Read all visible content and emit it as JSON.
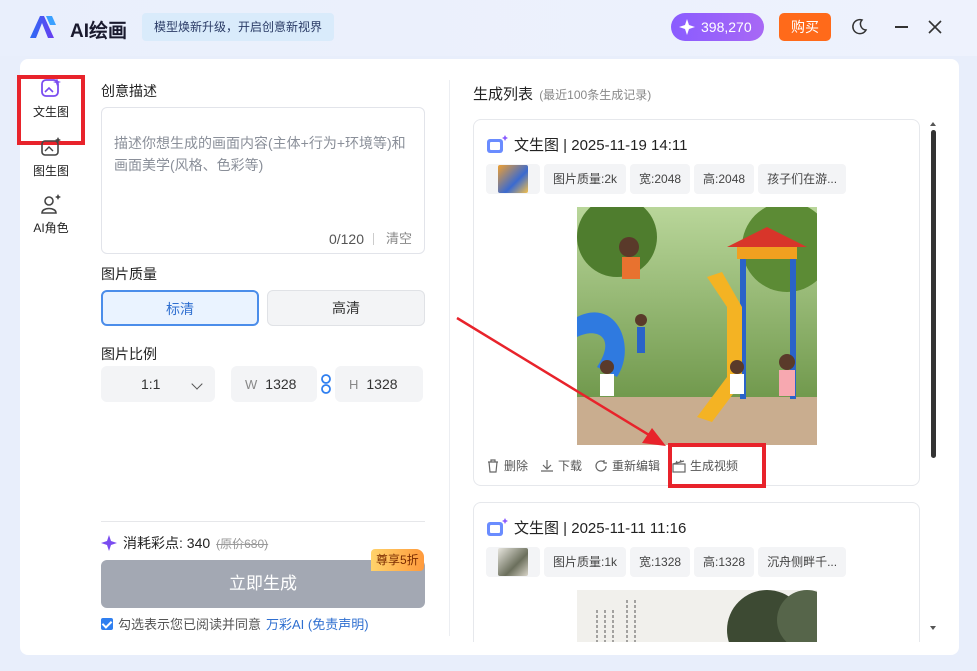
{
  "app": {
    "title": "AI绘画",
    "promo": "模型焕新升级，开启创意新视界",
    "points": "398,270",
    "buy_label": "购买",
    "logo_icon": "ai-logo-icon",
    "theme_icon": "moon-icon",
    "accent": "#4b8dea",
    "highlight": "#e8232b"
  },
  "sidebar": {
    "items": [
      {
        "label": "文生图",
        "icon": "text-to-image-icon",
        "active": true
      },
      {
        "label": "图生图",
        "icon": "image-to-image-icon",
        "active": false
      },
      {
        "label": "AI角色",
        "icon": "ai-character-icon",
        "active": false
      }
    ]
  },
  "form": {
    "desc_label": "创意描述",
    "desc_placeholder": "描述你想生成的画面内容(主体+行为+环境等)和画面美学(风格、色彩等)",
    "desc_count": "0/120",
    "clear_label": "清空",
    "quality_label": "图片质量",
    "quality_options": [
      "标清",
      "高清"
    ],
    "quality_selected": "标清",
    "ratio_label": "图片比例",
    "ratio_value": "1:1",
    "width_key": "W",
    "width_value": "1328",
    "height_key": "H",
    "height_value": "1328",
    "cost_label": "消耗彩点: 340",
    "cost_original": "(原价680)",
    "generate_label": "立即生成",
    "discount_badge": "尊享5折",
    "agree_text": "勾选表示您已阅读并同意",
    "agree_link": "万彩AI (免责声明)"
  },
  "results": {
    "title": "生成列表",
    "subtitle": "(最近100条生成记录)",
    "cards": [
      {
        "header": "文生图 | 2025-11-19 14:11",
        "chips": [
          "图片质量:2k",
          "宽:2048",
          "高:2048",
          "孩子们在游..."
        ],
        "actions": [
          "删除",
          "下载",
          "重新编辑",
          "生成视频"
        ]
      },
      {
        "header": "文生图 | 2025-11-11 11:16",
        "chips": [
          "图片质量:1k",
          "宽:1328",
          "高:1328",
          "沉舟侧畔千..."
        ]
      }
    ]
  }
}
